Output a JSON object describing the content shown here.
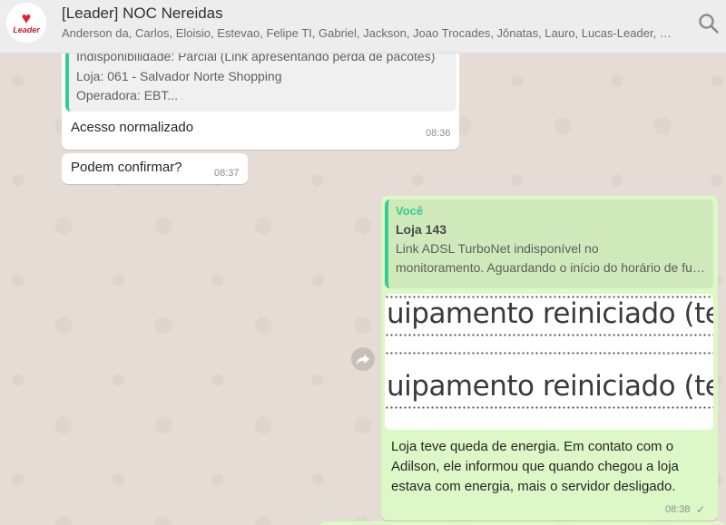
{
  "header": {
    "title": "[Leader] NOC Nereidas",
    "participants": "Anderson da, Carlos, Eloisio, Estevao, Felipe TI, Gabriel, Jackson, Joao Trocades, Jônatas, Lauro, Lucas-Leader, Maria, Paulo, Rafael, Thiago, Vinicius",
    "avatar_brand": "Leader",
    "avatar_icon": "heart-logo",
    "search_icon": "search-icon"
  },
  "messages": {
    "msg1": {
      "quote_lines": [
        "Indisponibilidade: Parcial (Link apresentando perda de pacotes)",
        "Loja: 061 - Salvador Norte Shopping",
        "Operadora: EBT..."
      ],
      "text": "Acesso normalizado",
      "time": "08:36"
    },
    "msg2": {
      "text": "Podem confirmar?",
      "time": "08:37"
    },
    "msg3": {
      "quote_author": "Você",
      "quote_title": "Loja 143",
      "quote_lines": [
        "Link ADSL TurboNet indisponível no",
        "monitoramento. Aguardando o início do horário de funcionamento"
      ],
      "image_lines": [
        "uipamento reiniciado (tem",
        "uipamento reiniciado (tem"
      ],
      "text_lines": [
        "Loja teve queda de energia. Em contato com o",
        "Adilson, ele informou que quando chegou a loja",
        "estava com energia, mais o servidor desligado."
      ],
      "time": "08:38",
      "status": "✓"
    }
  },
  "colors": {
    "header_bg": "#ededed",
    "chat_bg": "#e5ddd5",
    "incoming_bubble": "#ffffff",
    "outgoing_bubble": "#dcf8c6",
    "quote_accent": "#35cd96"
  }
}
